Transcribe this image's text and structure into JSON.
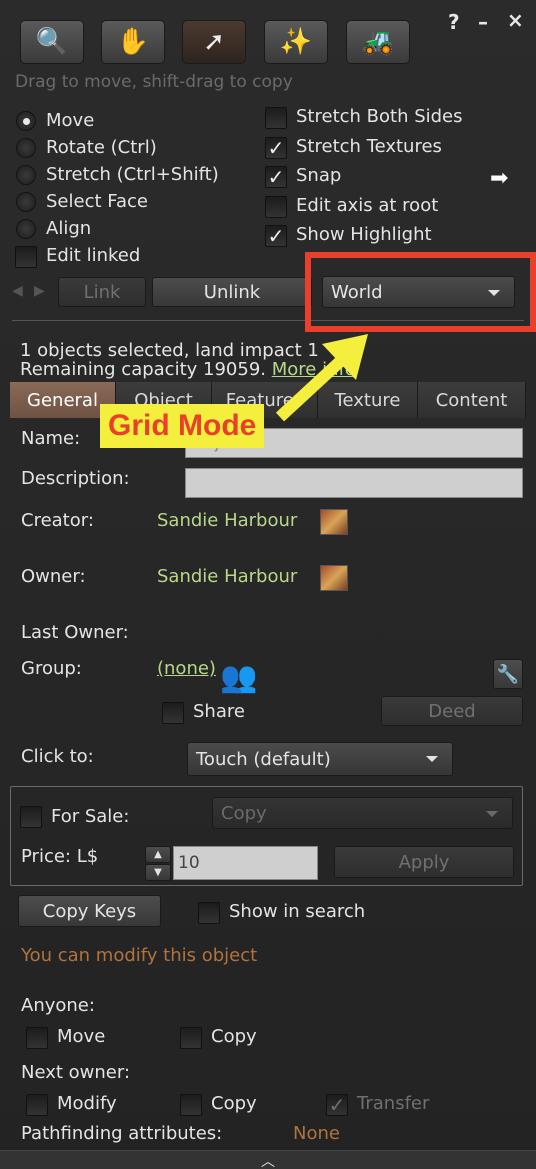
{
  "window": {
    "help": "?",
    "minimize": "–",
    "close": "×"
  },
  "toolbar": {
    "hint": "Drag to move, shift-drag to copy"
  },
  "modes": {
    "move": "Move",
    "rotate": "Rotate (Ctrl)",
    "stretch": "Stretch (Ctrl+Shift)",
    "select_face": "Select Face",
    "align": "Align",
    "edit_linked": "Edit linked"
  },
  "options": {
    "stretch_both_sides": "Stretch Both Sides",
    "stretch_textures": "Stretch Textures",
    "snap": "Snap",
    "edit_axis_at_root": "Edit axis at root",
    "show_highlight": "Show Highlight"
  },
  "link_bar": {
    "link": "Link",
    "unlink": "Unlink",
    "grid_mode": "World"
  },
  "annotation": {
    "label": "Grid Mode",
    "box_color": "#e8402a",
    "arrow_color": "#f4ef3c"
  },
  "selection": {
    "line1": "1 objects selected, land impact 1",
    "line2_prefix": "Remaining capacity 19059. ",
    "more_info": "More info"
  },
  "tabs": [
    "General",
    "Object",
    "Features",
    "Texture",
    "Content"
  ],
  "general": {
    "name_label": "Name:",
    "name_value": "Object",
    "description_label": "Description:",
    "creator_label": "Creator:",
    "creator_value": "Sandie Harbour",
    "owner_label": "Owner:",
    "owner_value": "Sandie Harbour",
    "last_owner_label": "Last Owner:",
    "group_label": "Group:",
    "group_value": "(none)",
    "share": "Share",
    "deed": "Deed",
    "click_to_label": "Click to:",
    "click_to_value": "Touch  (default)"
  },
  "sale": {
    "for_sale": "For Sale:",
    "sale_type": "Copy",
    "price_label": "Price: L$",
    "price_value": "10",
    "apply": "Apply"
  },
  "misc": {
    "copy_keys": "Copy Keys",
    "show_in_search": "Show in search",
    "modify_note": "You can modify this object"
  },
  "permissions": {
    "anyone_label": "Anyone:",
    "anyone_move": "Move",
    "anyone_copy": "Copy",
    "next_owner_label": "Next owner:",
    "next_modify": "Modify",
    "next_copy": "Copy",
    "next_transfer": "Transfer",
    "pathfinding_label": "Pathfinding attributes:",
    "pathfinding_value": "None"
  }
}
